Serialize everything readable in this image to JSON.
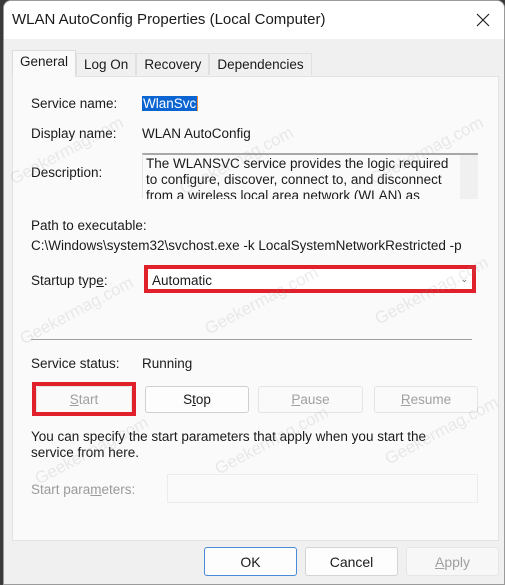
{
  "window": {
    "title": "WLAN AutoConfig Properties (Local Computer)"
  },
  "tabs": [
    {
      "label": "General",
      "active": true
    },
    {
      "label": "Log On",
      "active": false
    },
    {
      "label": "Recovery",
      "active": false
    },
    {
      "label": "Dependencies",
      "active": false
    }
  ],
  "general": {
    "service_name_label": "Service name:",
    "service_name_value": "WlanSvc",
    "display_name_label": "Display name:",
    "display_name_value": "WLAN AutoConfig",
    "description_label": "Description:",
    "description_value": "The WLANSVC service provides the logic required to configure, discover, connect to, and disconnect from a wireless local area network (WLAN) as defined by",
    "path_label": "Path to executable:",
    "path_value": "C:\\Windows\\system32\\svchost.exe -k LocalSystemNetworkRestricted -p",
    "startup_type_label_pre": "Startup typ",
    "startup_type_label_u": "e",
    "startup_type_label_post": ":",
    "startup_type_value": "Automatic",
    "service_status_label": "Service status:",
    "service_status_value": "Running",
    "buttons": {
      "start": {
        "u": "S",
        "rest": "tart",
        "enabled": false
      },
      "stop": {
        "pre": "S",
        "u": "t",
        "rest": "op",
        "enabled": true
      },
      "pause": {
        "u": "P",
        "rest": "ause",
        "enabled": false
      },
      "resume": {
        "u": "R",
        "rest": "esume",
        "enabled": false
      }
    },
    "note": "You can specify the start parameters that apply when you start the service from here.",
    "start_params_label_pre": "Start para",
    "start_params_label_u": "m",
    "start_params_label_post": "eters:",
    "start_params_value": ""
  },
  "footer": {
    "ok": "OK",
    "cancel": "Cancel",
    "apply_u": "A",
    "apply_rest": "pply"
  },
  "watermark": "Geekermag.com",
  "colors": {
    "highlight_box": "#e0202a",
    "selection": "#0a64d2"
  }
}
